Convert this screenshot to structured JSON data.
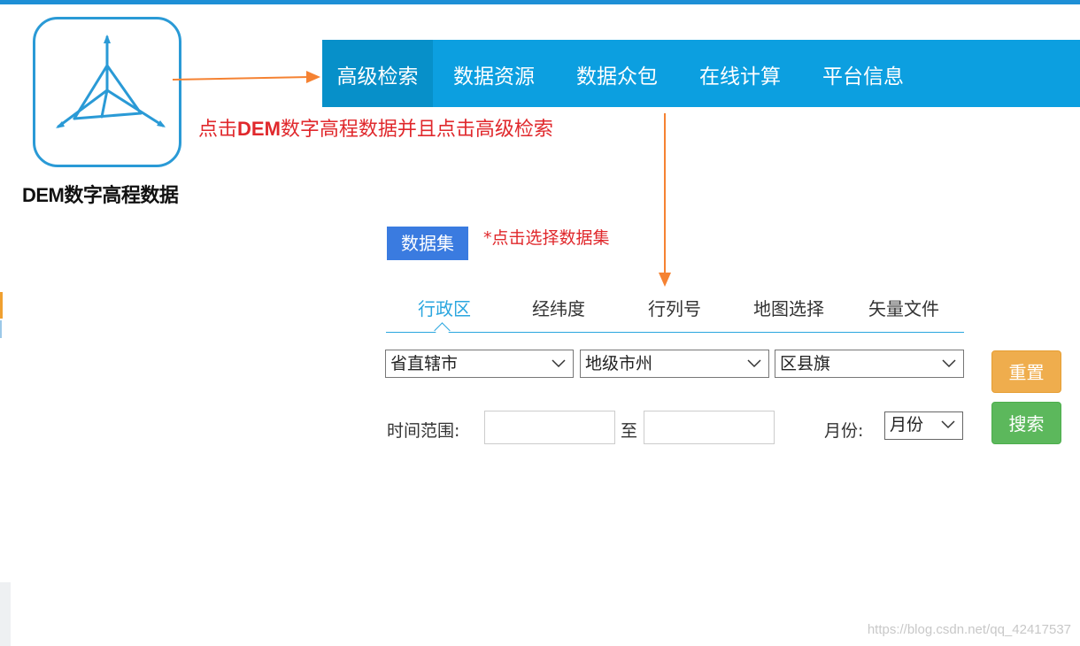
{
  "logo": {
    "caption": "DEM数字高程数据",
    "icon": "terrain-axes-icon"
  },
  "annotations": {
    "main_prefix": "点击",
    "main_bold": "DEM",
    "main_suffix": "数字高程数据并且点击高级检索",
    "dataset_hint": "*点击选择数据集",
    "color": "#e0282c",
    "arrow_color": "#f58232"
  },
  "nav": {
    "items": [
      {
        "label": "高级检索",
        "active": true
      },
      {
        "label": "数据资源"
      },
      {
        "label": "数据众包"
      },
      {
        "label": "在线计算"
      },
      {
        "label": "平台信息"
      }
    ],
    "color": "#0c9fe0"
  },
  "dataset": {
    "button_label": "数据集"
  },
  "tabs": [
    {
      "label": "行政区",
      "active": true
    },
    {
      "label": "经纬度"
    },
    {
      "label": "行列号"
    },
    {
      "label": "地图选择"
    },
    {
      "label": "矢量文件"
    }
  ],
  "region_selects": [
    {
      "value": "省直辖市"
    },
    {
      "value": "地级市州"
    },
    {
      "value": "区县旗"
    }
  ],
  "time_range": {
    "label": "时间范围:",
    "start_value": "",
    "separator": "至",
    "end_value": ""
  },
  "month": {
    "label": "月份:",
    "value": "月份"
  },
  "buttons": {
    "reset": "重置",
    "search": "搜索"
  },
  "watermark": "https://blog.csdn.net/qq_42417537"
}
